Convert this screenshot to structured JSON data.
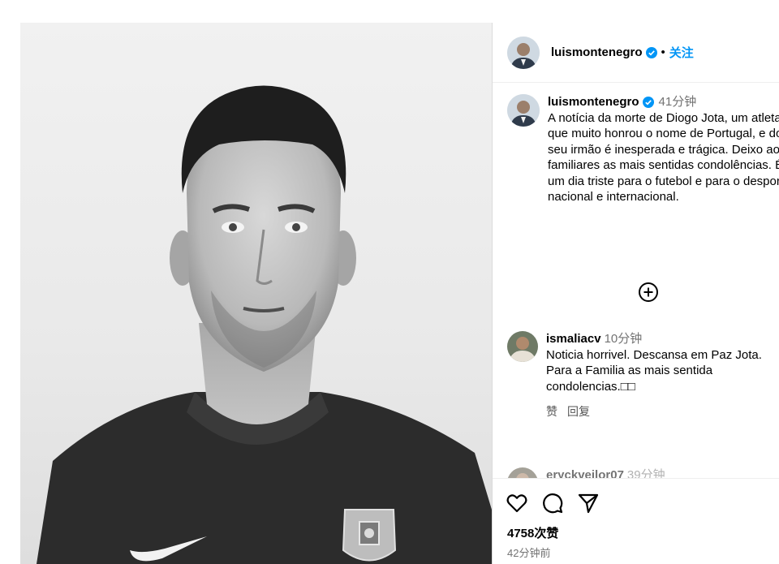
{
  "post": {
    "image_alt": "Diogo Jota portrait",
    "header": {
      "username": "luismontenegro",
      "separator": "•",
      "follow_label": "关注"
    },
    "caption": {
      "username": "luismontenegro",
      "time": "41分钟",
      "text": "A notícia da morte de Diogo Jota, um atleta que muito honrou o nome de Portugal, e do seu irmão é inesperada e trágica. Deixo aos familiares as mais sentidas condolências. É um dia triste para o futebol e para o desporto nacional e internacional."
    },
    "comments": [
      {
        "username": "ismaliacv",
        "time": "10分钟",
        "lines": [
          "Noticia horrivel. Descansa em Paz Jota.",
          "Para a Familia as mais sentida condolencias.□□"
        ],
        "like_label": "赞",
        "reply_label": "回复"
      },
      {
        "username": "eryckveilor07",
        "time": "39分钟"
      }
    ],
    "likes": "4758次赞",
    "posted_ago": "42分钟前"
  },
  "colors": {
    "accent": "#0095f6",
    "verified": "#0095f6",
    "muted": "#737373"
  },
  "icons": [
    "heart-icon",
    "comment-icon",
    "share-icon",
    "add-circle-icon",
    "verified-badge-icon"
  ]
}
